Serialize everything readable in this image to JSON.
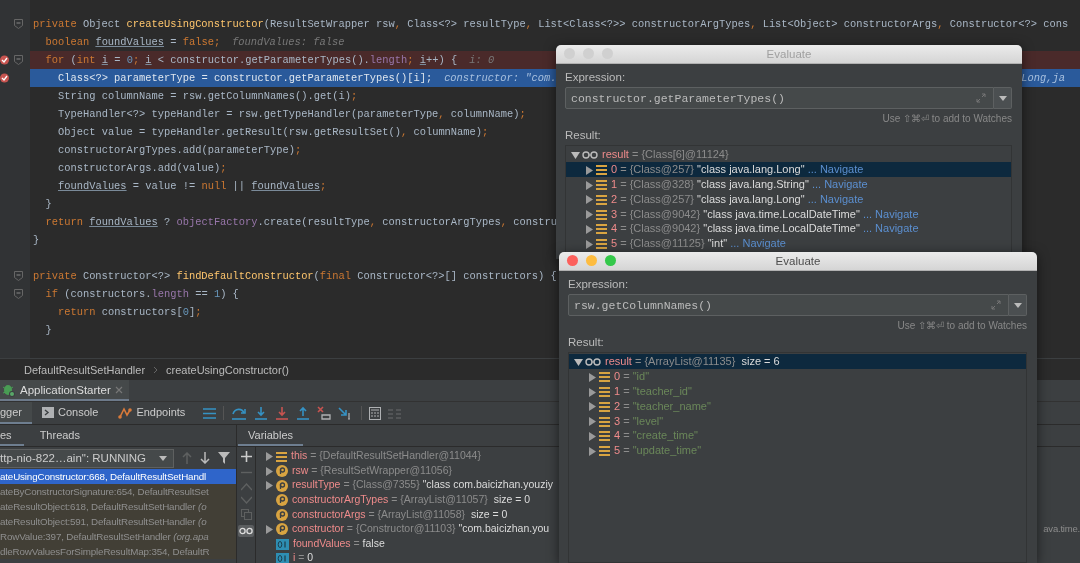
{
  "editor": {
    "lines": [
      {
        "kind": "code",
        "folded": false,
        "breakpoint": false,
        "current": false,
        "segments": [
          {
            "kind": "kw",
            "text": "private "
          },
          {
            "kind": "plain",
            "text": "Object "
          },
          {
            "kind": "fn",
            "text": "createUsingConstructor"
          },
          {
            "kind": "plain",
            "text": "(ResultSetWrapper rsw"
          },
          {
            "kind": "kw",
            "text": ", "
          },
          {
            "kind": "plain",
            "text": "Class<?> resultType"
          },
          {
            "kind": "kw",
            "text": ", "
          },
          {
            "kind": "plain",
            "text": "List<Class<?>> constructorArgTypes"
          },
          {
            "kind": "kw",
            "text": ", "
          },
          {
            "kind": "plain",
            "text": "List<Object> constructorArgs"
          },
          {
            "kind": "kw",
            "text": ", "
          },
          {
            "kind": "plain",
            "text": "Constructor<?> cons"
          }
        ],
        "children": [
          {
            "kind": "code",
            "breakpoint": false,
            "current": false,
            "segments": [
              {
                "kind": "kw",
                "text": "boolean "
              },
              {
                "kind": "local",
                "text": "foundValues"
              },
              {
                "kind": "plain",
                "text": " = "
              },
              {
                "kind": "kw",
                "text": "false;"
              }
            ],
            "hint": "foundValues: false"
          },
          {
            "kind": "code",
            "folded": false,
            "breakpoint": true,
            "current": false,
            "segments": [
              {
                "kind": "kw",
                "text": "for "
              },
              {
                "kind": "plain",
                "text": "("
              },
              {
                "kind": "kw",
                "text": "int "
              },
              {
                "kind": "local",
                "text": "i"
              },
              {
                "kind": "plain",
                "text": " = "
              },
              {
                "kind": "num",
                "text": "0"
              },
              {
                "kind": "kw",
                "text": "; "
              },
              {
                "kind": "local",
                "text": "i"
              },
              {
                "kind": "plain",
                "text": " < constructor.getParameterTypes()."
              },
              {
                "kind": "field",
                "text": "length"
              },
              {
                "kind": "kw",
                "text": "; "
              },
              {
                "kind": "local",
                "text": "i"
              },
              {
                "kind": "plain",
                "text": "++) {"
              }
            ],
            "hint": "i: 0",
            "children": [
              {
                "kind": "code",
                "breakpoint": true,
                "current": true,
                "segments": [
                  {
                    "kind": "plain",
                    "text": "Class<?> parameterType = constructor.getParameterTypes()[i];"
                  }
                ],
                "hint": "constructor: \"com.",
                "tail": "Long,ja"
              },
              {
                "kind": "code",
                "breakpoint": false,
                "current": false,
                "segments": [
                  {
                    "kind": "plain",
                    "text": "String columnName = rsw.getColumnNames().get(i)"
                  },
                  {
                    "kind": "kw",
                    "text": ";"
                  }
                ]
              },
              {
                "kind": "code",
                "breakpoint": false,
                "current": false,
                "segments": [
                  {
                    "kind": "plain",
                    "text": "TypeHandler<?> typeHandler = rsw.getTypeHandler(parameterType"
                  },
                  {
                    "kind": "kw",
                    "text": ", "
                  },
                  {
                    "kind": "plain",
                    "text": "columnName)"
                  },
                  {
                    "kind": "kw",
                    "text": ";"
                  }
                ]
              },
              {
                "kind": "code",
                "breakpoint": false,
                "current": false,
                "segments": [
                  {
                    "kind": "plain",
                    "text": "Object value = typeHandler.getResult(rsw.getResultSet()"
                  },
                  {
                    "kind": "kw",
                    "text": ", "
                  },
                  {
                    "kind": "plain",
                    "text": "columnName)"
                  },
                  {
                    "kind": "kw",
                    "text": ";"
                  }
                ]
              },
              {
                "kind": "code",
                "breakpoint": false,
                "current": false,
                "segments": [
                  {
                    "kind": "plain",
                    "text": "constructorArgTypes.add(parameterType)"
                  },
                  {
                    "kind": "kw",
                    "text": ";"
                  }
                ]
              },
              {
                "kind": "code",
                "breakpoint": false,
                "current": false,
                "segments": [
                  {
                    "kind": "plain",
                    "text": "constructorArgs.add(value)"
                  },
                  {
                    "kind": "kw",
                    "text": ";"
                  }
                ]
              },
              {
                "kind": "code",
                "breakpoint": false,
                "current": false,
                "segments": [
                  {
                    "kind": "local",
                    "text": "foundValues"
                  },
                  {
                    "kind": "plain",
                    "text": " = value != "
                  },
                  {
                    "kind": "kw",
                    "text": "null"
                  },
                  {
                    "kind": "plain",
                    "text": " || "
                  },
                  {
                    "kind": "local",
                    "text": "foundValues"
                  },
                  {
                    "kind": "kw",
                    "text": ";"
                  }
                ]
              }
            ]
          },
          {
            "kind": "code",
            "breakpoint": false,
            "current": false,
            "segments": [
              {
                "kind": "plain",
                "text": "}"
              }
            ]
          },
          {
            "kind": "code",
            "breakpoint": false,
            "current": false,
            "segments": [
              {
                "kind": "kw",
                "text": "return "
              },
              {
                "kind": "local",
                "text": "foundValues"
              },
              {
                "kind": "plain",
                "text": " ? "
              },
              {
                "kind": "field",
                "text": "objectFactory"
              },
              {
                "kind": "plain",
                "text": ".create(resultType"
              },
              {
                "kind": "kw",
                "text": ", "
              },
              {
                "kind": "plain",
                "text": "constructorArgTypes"
              },
              {
                "kind": "kw",
                "text": ", "
              },
              {
                "kind": "plain",
                "text": "constru"
              }
            ]
          }
        ]
      },
      {
        "kind": "code",
        "breakpoint": false,
        "current": false,
        "segments": [
          {
            "kind": "plain",
            "text": "}"
          }
        ]
      },
      {
        "kind": "blank"
      },
      {
        "kind": "code",
        "folded": false,
        "breakpoint": false,
        "current": false,
        "segments": [
          {
            "kind": "kw",
            "text": "private "
          },
          {
            "kind": "plain",
            "text": "Constructor<?> "
          },
          {
            "kind": "fn",
            "text": "findDefaultConstructor"
          },
          {
            "kind": "plain",
            "text": "("
          },
          {
            "kind": "kw",
            "text": "final "
          },
          {
            "kind": "plain",
            "text": "Constructor<?>[] constructors) {"
          }
        ],
        "children": [
          {
            "kind": "code",
            "folded": false,
            "breakpoint": false,
            "current": false,
            "segments": [
              {
                "kind": "kw",
                "text": "if "
              },
              {
                "kind": "plain",
                "text": "(constructors."
              },
              {
                "kind": "field",
                "text": "length"
              },
              {
                "kind": "plain",
                "text": " == "
              },
              {
                "kind": "num",
                "text": "1"
              },
              {
                "kind": "plain",
                "text": ") {"
              }
            ],
            "children": [
              {
                "kind": "code",
                "breakpoint": false,
                "current": false,
                "segments": [
                  {
                    "kind": "kw",
                    "text": "return "
                  },
                  {
                    "kind": "plain",
                    "text": "constructors["
                  },
                  {
                    "kind": "num",
                    "text": "0"
                  },
                  {
                    "kind": "plain",
                    "text": "]"
                  },
                  {
                    "kind": "kw",
                    "text": ";"
                  }
                ]
              }
            ]
          },
          {
            "kind": "code",
            "breakpoint": false,
            "current": false,
            "segments": [
              {
                "kind": "plain",
                "text": "}"
              }
            ]
          }
        ]
      }
    ]
  },
  "breadcrumb": [
    "DefaultResultSetHandler",
    "createUsingConstructor()"
  ],
  "run_tabs": [
    {
      "label": "ApplicationStarter",
      "selected": true
    }
  ],
  "debugger": {
    "tabs": [
      {
        "label": "gger",
        "kind": "debugger",
        "selected": true
      },
      {
        "label": "Console",
        "kind": "console",
        "selected": false
      },
      {
        "label": "Endpoints",
        "kind": "endpoints",
        "selected": false
      }
    ],
    "frame_tabs": [
      {
        "label": "es",
        "selected": true
      },
      {
        "label": "Threads",
        "selected": false
      }
    ],
    "variables_title": "Variables",
    "thread": "ttp-nio-822…ain\": RUNNING",
    "frames": [
      {
        "text": "ateUsingConstructor:668, DefaultResultSetHandl",
        "selected": true
      },
      {
        "text": "ateByConstructorSignature:654, DefaultResultSet",
        "selected": false
      },
      {
        "text": "ateResultObject:618, DefaultResultSetHandler *(o*",
        "selected": false
      },
      {
        "text": "ateResultObject:591, DefaultResultSetHandler *(o*",
        "selected": false
      },
      {
        "text": "RowValue:397, DefaultResultSetHandler *(org.apa*",
        "selected": false
      },
      {
        "text": "dleRowValuesForSimpleResultMap:354, DefaultR",
        "selected": false
      }
    ],
    "variables": [
      {
        "name": "this",
        "ref": "= {DefaultResultSetHandler@11044}",
        "kind": "this",
        "expanded": false
      },
      {
        "name": "rsw",
        "ref": "= {ResultSetWrapper@11056}",
        "kind": "param",
        "expanded": false
      },
      {
        "name": "resultType",
        "ref": "= {Class@7355}",
        "value": "\"class com.baicizhan.youziy",
        "kind": "param",
        "expanded": false
      },
      {
        "name": "constructorArgTypes",
        "ref": "= {ArrayList@11057}",
        "size": "size = 0",
        "kind": "param"
      },
      {
        "name": "constructorArgs",
        "ref": "= {ArrayList@11058}",
        "size": "size = 0",
        "kind": "param"
      },
      {
        "name": "constructor",
        "ref": "= {Constructor@11103}",
        "value": "\"com.baicizhan.you",
        "tail": "ava.time.",
        "kind": "param",
        "expanded": false
      },
      {
        "name": "foundValues",
        "ref": "=",
        "value": "false",
        "kind": "primitive"
      },
      {
        "name": "i",
        "ref": "=",
        "value": "0",
        "kind": "primitive"
      }
    ]
  },
  "dialogs": [
    {
      "title": "Evaluate",
      "active": false,
      "expression_label": "Expression:",
      "expression": "constructor.getParameterTypes()",
      "hint": "Use ⇧⌘⏎ to add to Watches",
      "result_label": "Result:",
      "result": [
        {
          "name": "result",
          "ref": "= {Class[6]@11124}",
          "kind": "watch",
          "expanded": true,
          "selected": false,
          "children": [
            {
              "name": "0",
              "ref": "= {Class@257}",
              "value": "\"class java.lang.Long\"",
              "link": "... Navigate",
              "kind": "element",
              "expanded": false,
              "selected": true
            },
            {
              "name": "1",
              "ref": "= {Class@328}",
              "value": "\"class java.lang.String\"",
              "link": "... Navigate",
              "kind": "element",
              "expanded": false,
              "selected": false
            },
            {
              "name": "2",
              "ref": "= {Class@257}",
              "value": "\"class java.lang.Long\"",
              "link": "... Navigate",
              "kind": "element",
              "expanded": false,
              "selected": false
            },
            {
              "name": "3",
              "ref": "= {Class@9042}",
              "value": "\"class java.time.LocalDateTime\"",
              "link": "... Navigate",
              "kind": "element",
              "expanded": false,
              "selected": false
            },
            {
              "name": "4",
              "ref": "= {Class@9042}",
              "value": "\"class java.time.LocalDateTime\"",
              "link": "... Navigate",
              "kind": "element",
              "expanded": false,
              "selected": false
            },
            {
              "name": "5",
              "ref": "= {Class@11125}",
              "value": "\"int\"",
              "link": "... Navigate",
              "kind": "element",
              "expanded": false,
              "selected": false
            }
          ]
        }
      ]
    },
    {
      "title": "Evaluate",
      "active": true,
      "expression_label": "Expression:",
      "expression": "rsw.getColumnNames()",
      "hint": "Use ⇧⌘⏎ to add to Watches",
      "result_label": "Result:",
      "result": [
        {
          "name": "result",
          "ref": "= {ArrayList@11135}",
          "size": "size = 6",
          "kind": "watch",
          "expanded": true,
          "selected": true,
          "children": [
            {
              "name": "0",
              "ref": "=",
              "value": "\"id\"",
              "kind": "string_element",
              "expanded": false,
              "selected": false
            },
            {
              "name": "1",
              "ref": "=",
              "value": "\"teacher_id\"",
              "kind": "string_element",
              "expanded": false,
              "selected": false
            },
            {
              "name": "2",
              "ref": "=",
              "value": "\"teacher_name\"",
              "kind": "string_element",
              "expanded": false,
              "selected": false
            },
            {
              "name": "3",
              "ref": "=",
              "value": "\"level\"",
              "kind": "string_element",
              "expanded": false,
              "selected": false
            },
            {
              "name": "4",
              "ref": "=",
              "value": "\"create_time\"",
              "kind": "string_element",
              "expanded": false,
              "selected": false
            },
            {
              "name": "5",
              "ref": "=",
              "value": "\"update_time\"",
              "kind": "string_element",
              "expanded": false,
              "selected": false
            }
          ]
        }
      ]
    }
  ]
}
